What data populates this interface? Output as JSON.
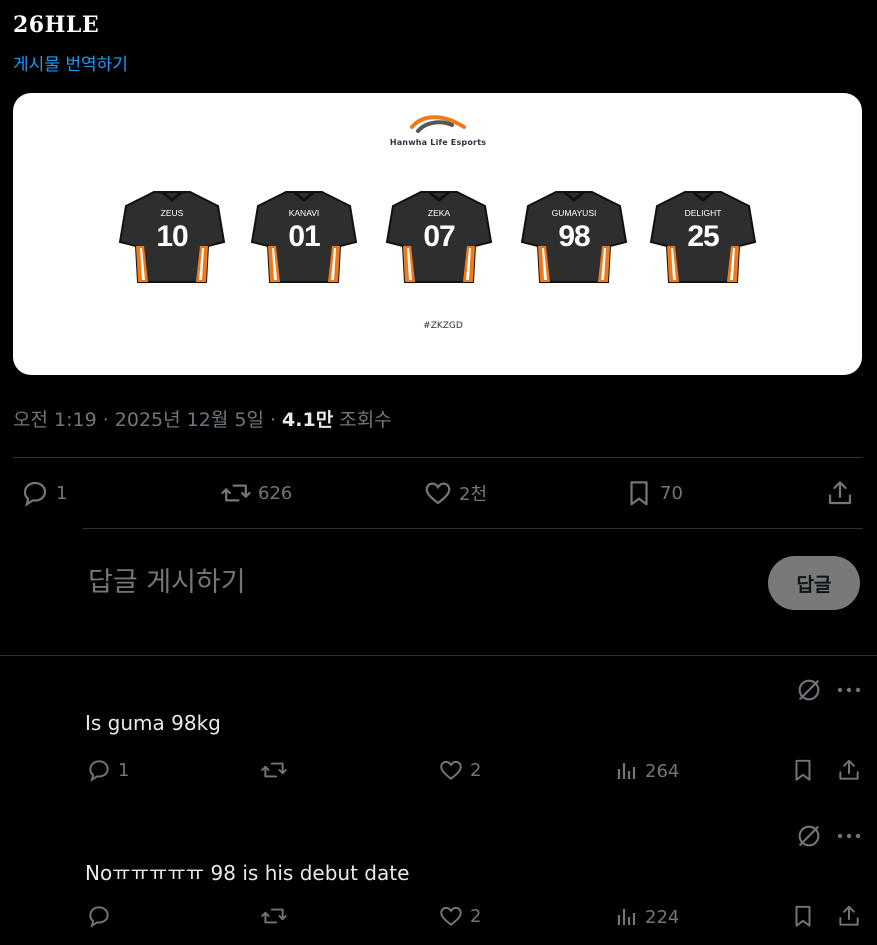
{
  "post": {
    "text": "26HLE",
    "translate_label": "게시물 번역하기",
    "image": {
      "logo_text": "Hanwha Life Esports",
      "players": [
        {
          "name": "ZEUS",
          "number": "10"
        },
        {
          "name": "KANAVI",
          "number": "01"
        },
        {
          "name": "ZEKA",
          "number": "07"
        },
        {
          "name": "GUMAYUSI",
          "number": "98"
        },
        {
          "name": "DELIGHT",
          "number": "25"
        }
      ],
      "hashtag": "#ZKZGD"
    },
    "timestamp": "오전 1:19 · 2025년 12월 5일 · ",
    "views_count": "4.1만",
    "views_label": " 조회수",
    "stats": {
      "replies": "1",
      "reposts": "626",
      "likes": "2천",
      "bookmarks": "70"
    }
  },
  "reply_composer": {
    "placeholder": "답글 게시하기",
    "button_label": "답글"
  },
  "replies": [
    {
      "text": "Is guma 98kg",
      "replies": "1",
      "reposts": "",
      "likes": "2",
      "views": "264"
    },
    {
      "text": "Noㅠㅠㅠㅠㅠ 98 is his debut date",
      "replies": "",
      "reposts": "",
      "likes": "2",
      "views": "224"
    }
  ],
  "colors": {
    "background": "#000000",
    "text": "#e7e9ea",
    "muted": "#71767b",
    "accent": "#1d9bf0",
    "divider": "#2f3336",
    "jersey_body": "#2e2e2e",
    "jersey_accent": "#f07a1a"
  }
}
